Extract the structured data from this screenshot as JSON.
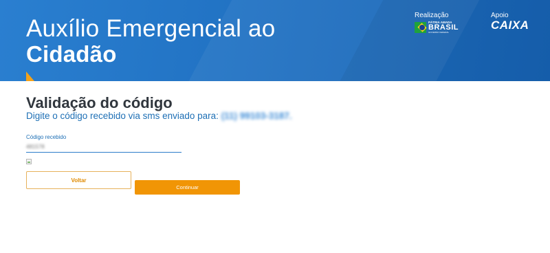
{
  "header": {
    "title_line1": "Auxílio Emergencial ao",
    "title_line2": "Cidadão",
    "realizacao_label": "Realização",
    "brasil_logo": {
      "line1": "PÁTRIA AMADA",
      "line2": "BRASIL",
      "line3": "GOVERNO FEDERAL"
    },
    "apoio_label": "Apoio",
    "caixa_logo": "CAIXA"
  },
  "main": {
    "title": "Validação do código",
    "subtitle_prefix": "Digite o código recebido via sms enviado para:",
    "subtitle_phone": "(11) 99103-3187.",
    "code_field": {
      "label": "Código recebido",
      "value": "481578"
    },
    "buttons": {
      "back": "Voltar",
      "continue": "Continuar"
    }
  },
  "colors": {
    "header_blue": "#1f6fc0",
    "accent_orange": "#f19505",
    "title_dark": "#30363d",
    "link_blue": "#1d6fb5"
  }
}
